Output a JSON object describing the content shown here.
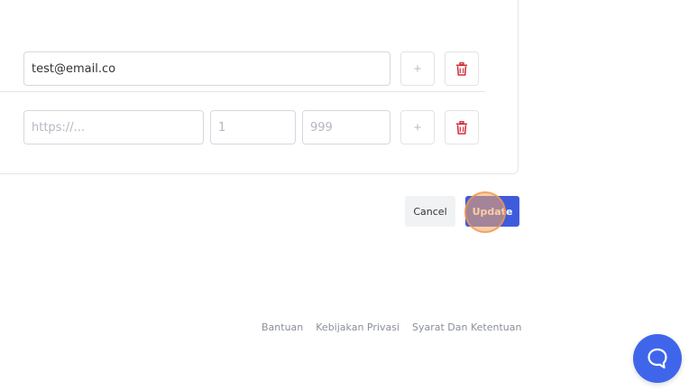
{
  "form": {
    "email_row": {
      "email_value": "test@email.co",
      "add_label": "+",
      "delete_icon": "trash-icon"
    },
    "link_row": {
      "url_placeholder": "https://...",
      "min_placeholder": "1",
      "max_placeholder": "999",
      "add_label": "+",
      "delete_icon": "trash-icon"
    }
  },
  "actions": {
    "cancel_label": "Cancel",
    "update_label": "Update"
  },
  "footer": {
    "links": [
      "Bantuan",
      "Kebijakan Privasi",
      "Syarat Dan Ketentuan"
    ]
  },
  "chat": {
    "icon": "chat-bubble-icon"
  },
  "colors": {
    "primary": "#3f5bdc",
    "danger": "#d32f3a",
    "chat": "#3f66ea"
  }
}
